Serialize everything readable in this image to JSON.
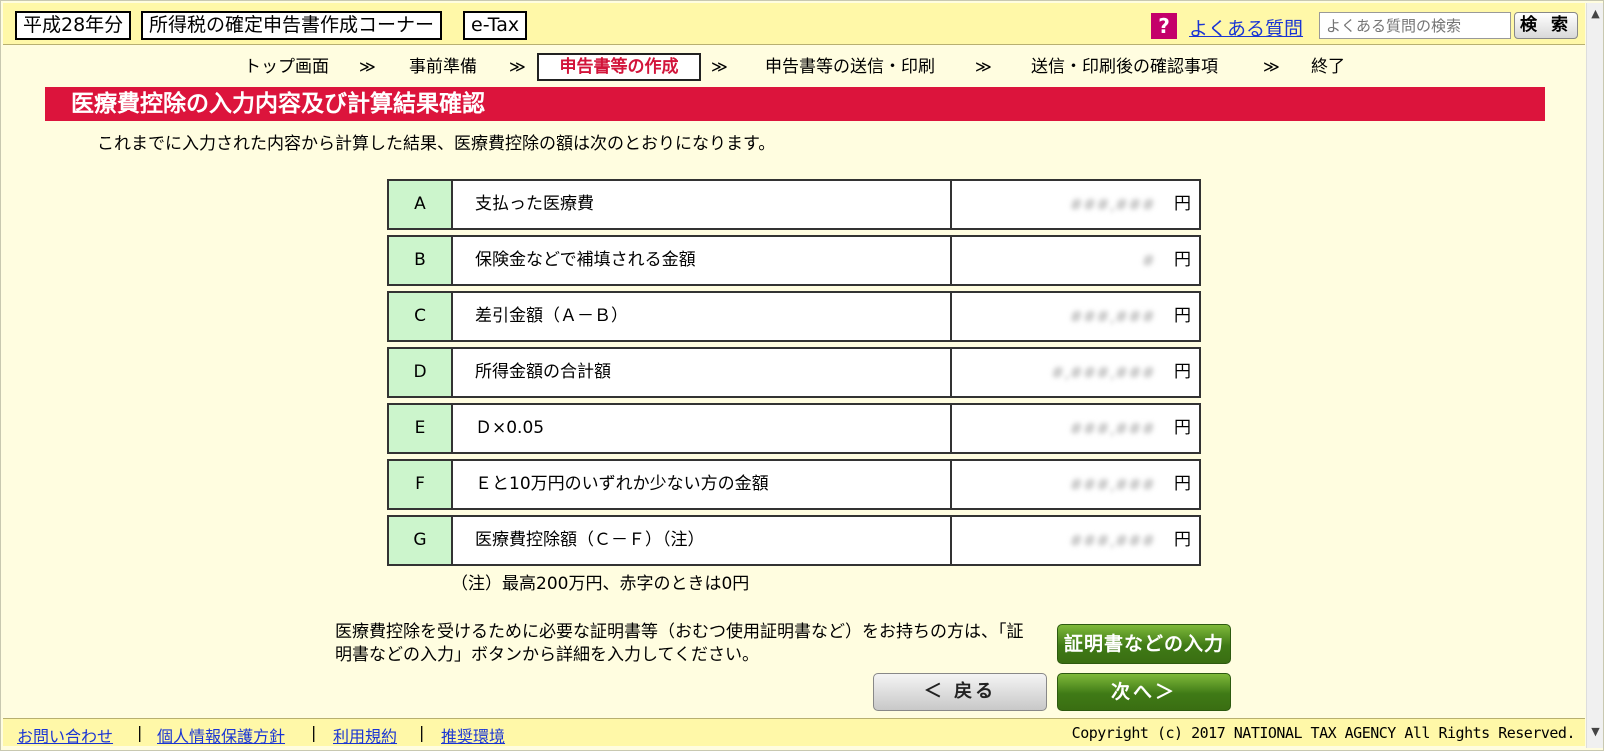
{
  "header": {
    "year_label": "平成28年分",
    "corner_title": "所得税の確定申告書作成コーナー",
    "etax_label": "e-Tax",
    "faq_icon": "?",
    "faq_link": "よくある質問",
    "faq_search_placeholder": "よくある質問の検索",
    "search_button": "検 索"
  },
  "steps": {
    "items": [
      "トップ画面",
      "事前準備",
      "申告書等の作成",
      "申告書等の送信・印刷",
      "送信・印刷後の確認事項",
      "終了"
    ],
    "separator": "≫",
    "current_index": 2
  },
  "page": {
    "title": "医療費控除の入力内容及び計算結果確認",
    "intro": "これまでに入力された内容から計算した結果、医療費控除の額は次のとおりになります。"
  },
  "table": {
    "yen_unit": "円",
    "rows": [
      {
        "code": "A",
        "label": "支払った医療費",
        "amount": "###,###"
      },
      {
        "code": "B",
        "label": "保険金などで補填される金額",
        "amount": "#"
      },
      {
        "code": "C",
        "label": "差引金額（Ａ－Ｂ）",
        "amount": "###,###"
      },
      {
        "code": "D",
        "label": "所得金額の合計額",
        "amount": "#,###,###"
      },
      {
        "code": "E",
        "label": "Ｄ×0.05",
        "amount": "###,###"
      },
      {
        "code": "F",
        "label": "Ｅと10万円のいずれか少ない方の金額",
        "amount": "###,###"
      },
      {
        "code": "G",
        "label": "医療費控除額（Ｃ－Ｆ）（注）",
        "amount": "###,###"
      }
    ]
  },
  "note": "（注）最高200万円、赤字のときは0円",
  "certificate": {
    "text": "医療費控除を受けるために必要な証明書等（おむつ使用証明書など）をお持ちの方は、「証明書などの入力」ボタンから詳細を入力してください。",
    "button": "証明書などの入力"
  },
  "nav": {
    "back": "＜ 戻る",
    "next": "次へ＞"
  },
  "footer": {
    "links": [
      "お問い合わせ",
      "個人情報保護方針",
      "利用規約",
      "推奨環境"
    ],
    "separator": "|",
    "copyright": "Copyright (c) 2017 NATIONAL TAX AGENCY All Rights Reserved."
  },
  "colors": {
    "header_bg": "#fff8a8",
    "page_bg": "#fffde0",
    "title_bg": "#dc143c",
    "code_cell_bg": "#ccf5cc",
    "green_button": "#4a8a1c",
    "link": "#1a35d4"
  }
}
